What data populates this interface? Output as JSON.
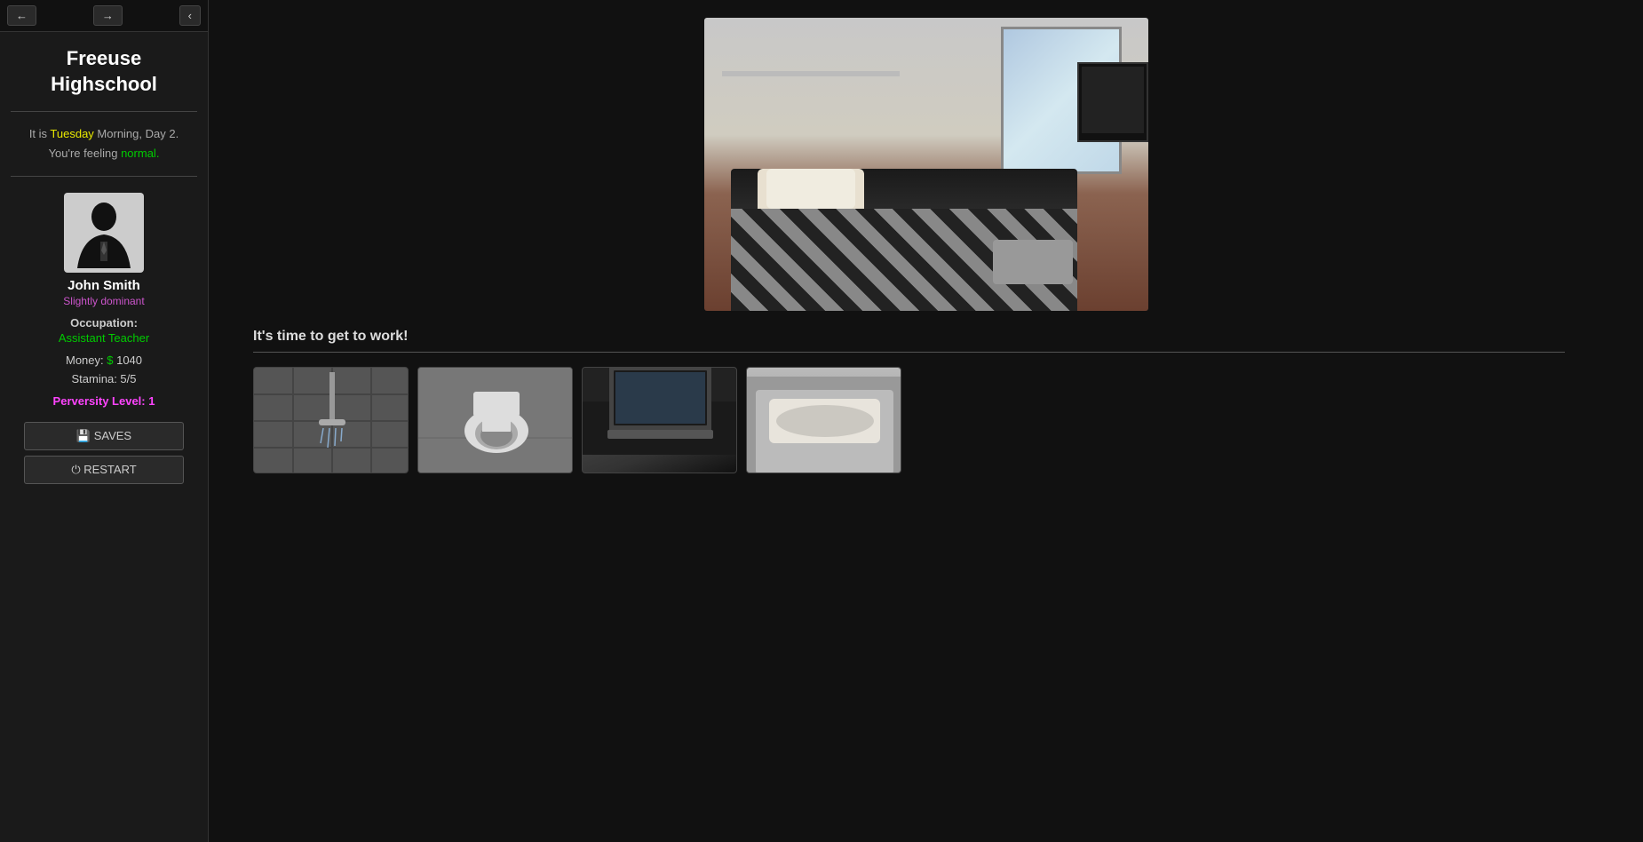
{
  "sidebar": {
    "title": "Freeuse\nHighschool",
    "nav": {
      "back_label": "←",
      "forward_label": "→",
      "collapse_label": "‹"
    },
    "day_info": {
      "prefix": "It is ",
      "day_name": "Tuesday",
      "suffix": " Morning, Day 2.",
      "feeling_prefix": "You're feeling ",
      "feeling": "normal.",
      "day_color": "#e8e800",
      "feeling_color": "#00cc00"
    },
    "character": {
      "name": "John Smith",
      "disposition": "Slightly dominant",
      "occupation_label": "Occupation:",
      "occupation": "Assistant Teacher",
      "money_label": "Money: $",
      "money_amount": "1040",
      "stamina_label": "Stamina:",
      "stamina_value": "5/5",
      "perversity_label": "Perversity Level:",
      "perversity_value": "1"
    },
    "buttons": {
      "saves": "💾 SAVES",
      "restart": "⏻ RESTART"
    }
  },
  "main": {
    "narrative": "It's time to get to work!",
    "choices": [
      {
        "id": "shower",
        "label": "Shower",
        "type": "shower"
      },
      {
        "id": "toilet",
        "label": "Toilet",
        "type": "toilet"
      },
      {
        "id": "laptop",
        "label": "Laptop",
        "type": "laptop"
      },
      {
        "id": "bed",
        "label": "Bed",
        "type": "bed"
      }
    ]
  }
}
